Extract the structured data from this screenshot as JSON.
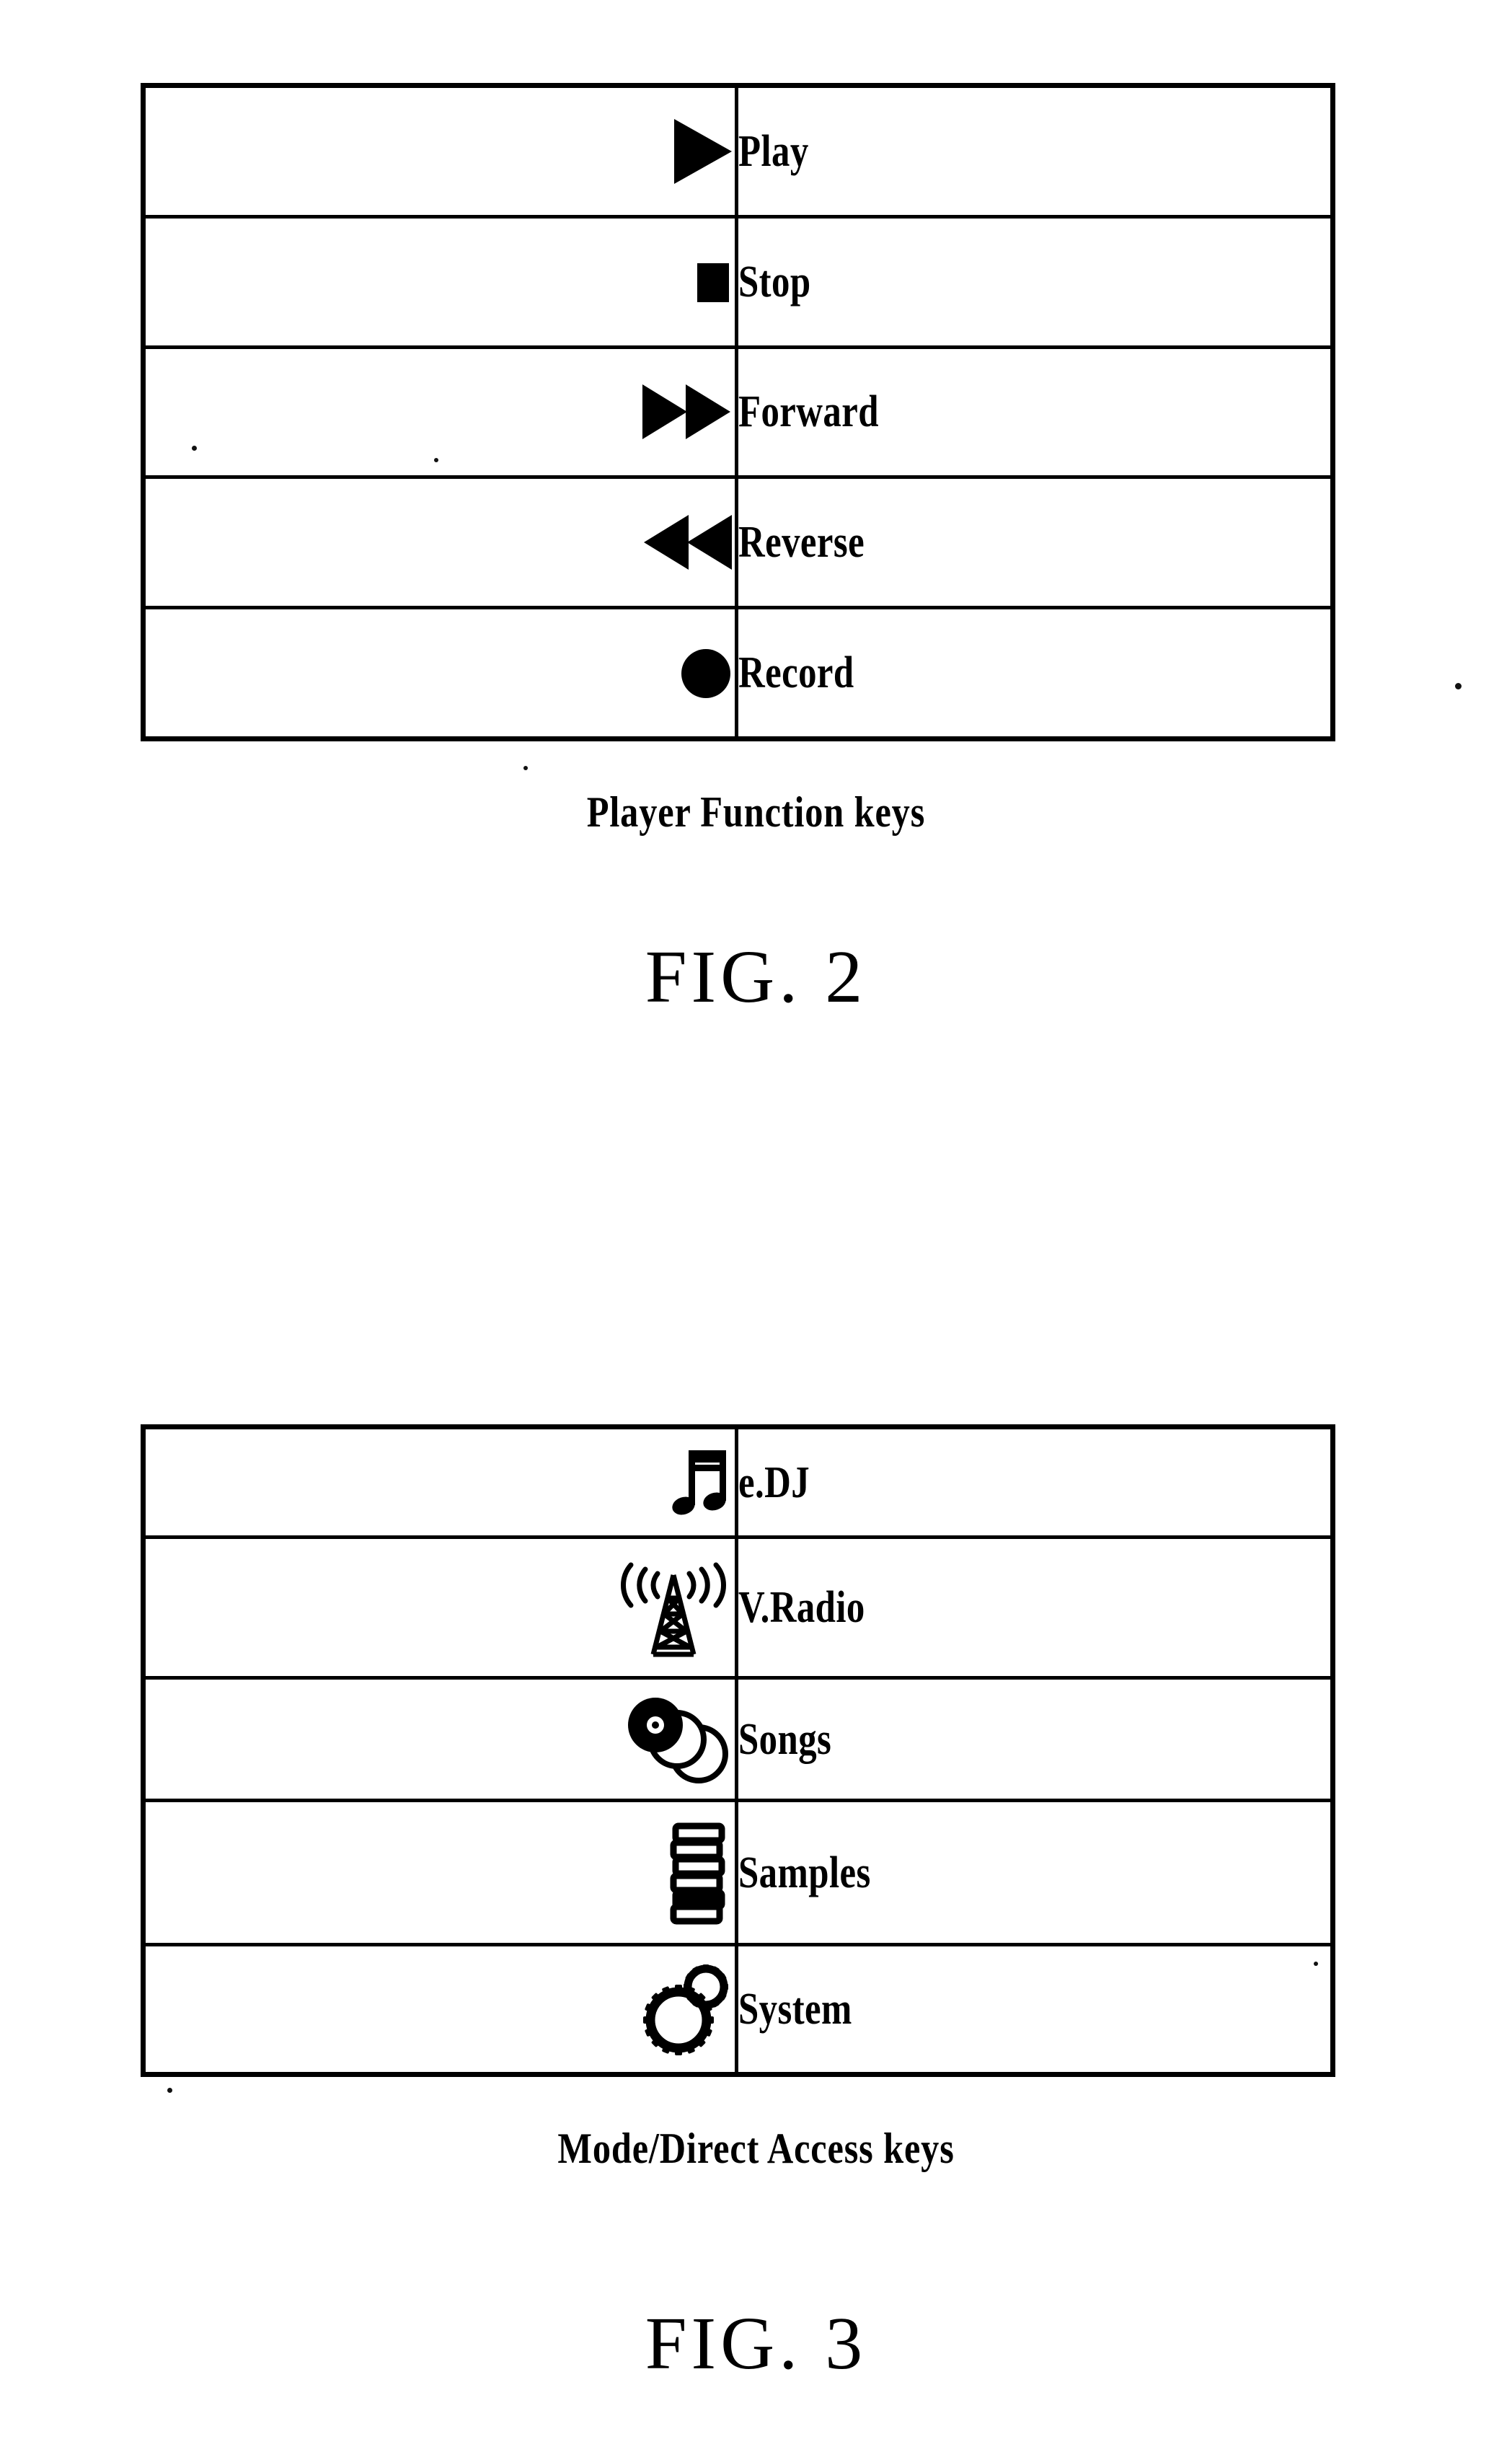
{
  "figures": [
    {
      "id": "fig2",
      "caption": "Player Function keys",
      "figure_label": "FIG. 2",
      "rows": [
        {
          "icon": "play-triangle-icon",
          "label": "Play"
        },
        {
          "icon": "stop-square-icon",
          "label": "Stop"
        },
        {
          "icon": "fast-forward-double-triangle-icon",
          "label": "Forward"
        },
        {
          "icon": "rewind-double-triangle-icon",
          "label": "Reverse"
        },
        {
          "icon": "record-circle-icon",
          "label": "Record"
        }
      ]
    },
    {
      "id": "fig3",
      "caption": "Mode/Direct Access keys",
      "figure_label": "FIG. 3",
      "rows": [
        {
          "icon": "beamed-eighth-notes-icon",
          "label": "e.DJ"
        },
        {
          "icon": "broadcast-tower-icon",
          "label": "V.Radio"
        },
        {
          "icon": "stacked-discs-icon",
          "label": "Songs"
        },
        {
          "icon": "stacked-slabs-icon",
          "label": "Samples"
        },
        {
          "icon": "gears-icon",
          "label": "System"
        }
      ]
    }
  ],
  "colors": {
    "ink": "#000000",
    "paper": "#ffffff"
  }
}
